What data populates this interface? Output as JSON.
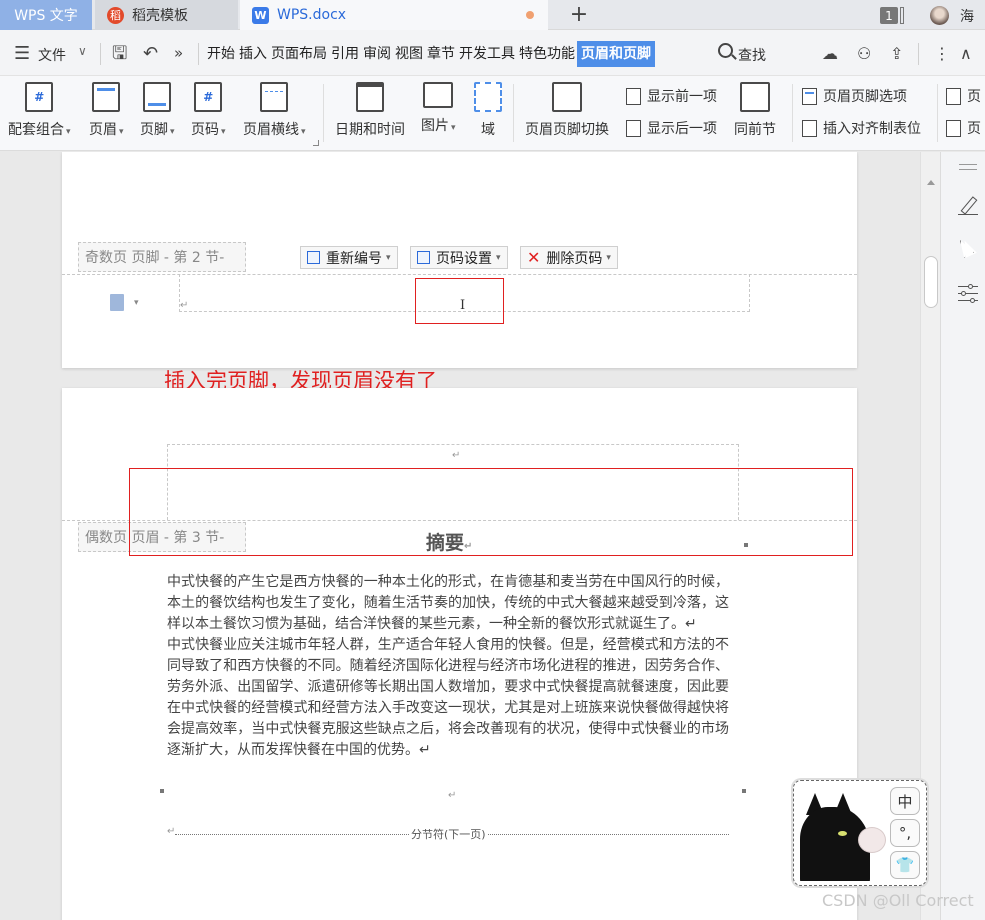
{
  "titlebar": {
    "app_tab": "WPS 文字",
    "tab_daoke": "稻壳模板",
    "tab_doc": "WPS.docx",
    "daoke_logo": "稻",
    "doc_logo": "W",
    "new_tab": "+",
    "window_count": "1",
    "user": "海"
  },
  "menubar": {
    "hamburger": "☰",
    "file": "文件",
    "file_chevron": "∨",
    "save_icon": "🖫",
    "undo_icon": "↶",
    "more_icon": "»",
    "tabs": [
      "开始",
      "插入",
      "页面布局",
      "引用",
      "审阅",
      "视图",
      "章节",
      "开发工具",
      "特色功能",
      "页眉和页脚"
    ],
    "active_tab": "页眉和页脚",
    "search": "查找",
    "right_icons": [
      "☁",
      "⚇",
      "⇪",
      "⋮",
      "∧"
    ]
  },
  "ribbon": {
    "combo": "配套组合",
    "header": "页眉",
    "footer": "页脚",
    "page_number": "页码",
    "header_line": "页眉横线",
    "date_time": "日期和时间",
    "picture": "图片",
    "field": "域",
    "switch": "页眉页脚切换",
    "show_prev": "显示前一项",
    "show_next": "显示后一项",
    "same_as_prev": "同前节",
    "hf_options": "页眉页脚选项",
    "insert_tab": "插入对齐制表位",
    "cut1": "页",
    "cut2": "页",
    "hash": "#"
  },
  "page1": {
    "footer_label": "奇数页 页脚  - 第 2 节-",
    "btn_renumber": "重新编号",
    "btn_page_setup": "页码设置",
    "btn_delete": "删除页码",
    "delete_x": "✕",
    "dropdown": "▾",
    "ibeam": "I"
  },
  "annotation": "插入完页脚，发现页眉没有了",
  "page2": {
    "header_label": "偶数页 页眉  - 第 3 节-",
    "title": "摘要",
    "paragraphs": [
      "中式快餐的产生它是西方快餐的一种本土化的形式，在肯德基和麦当劳在中国风行的时候，本土的餐饮结构也发生了变化，随着生活节奏的加快，传统的中式大餐越来越受到冷落，这样以本土餐饮习惯为基础，结合洋快餐的某些元素，一种全新的餐饮形式就诞生了。↵",
      "中式快餐业应关注城市年轻人群，生产适合年轻人食用的快餐。但是，经营模式和方法的不同导致了和西方快餐的不同。随着经济国际化进程与经济市场化进程的推进，因劳务合作、劳务外派、出国留学、派遣研修等长期出国人数增加，要求中式快餐提高就餐速度，因此要在中式快餐的经营模式和经营方法入手改变这一现状，尤其是对上班族来说快餐做得越快将会提高效率，当中式快餐克服这些缺点之后，将会改善现有的状况，使得中式快餐业的市场逐渐扩大，从而发挥快餐在中国的优势。↵"
    ],
    "section_break": "分节符(下一页)",
    "para_mark": "↵"
  },
  "ime": {
    "lang": "中",
    "punct": "°,",
    "skin": "👕"
  },
  "watermark": "CSDN @Oll Correct",
  "colors": {
    "accent": "#4e8ee8",
    "annotation_red": "#e02020",
    "wps_tab": "#8fb1e6"
  }
}
